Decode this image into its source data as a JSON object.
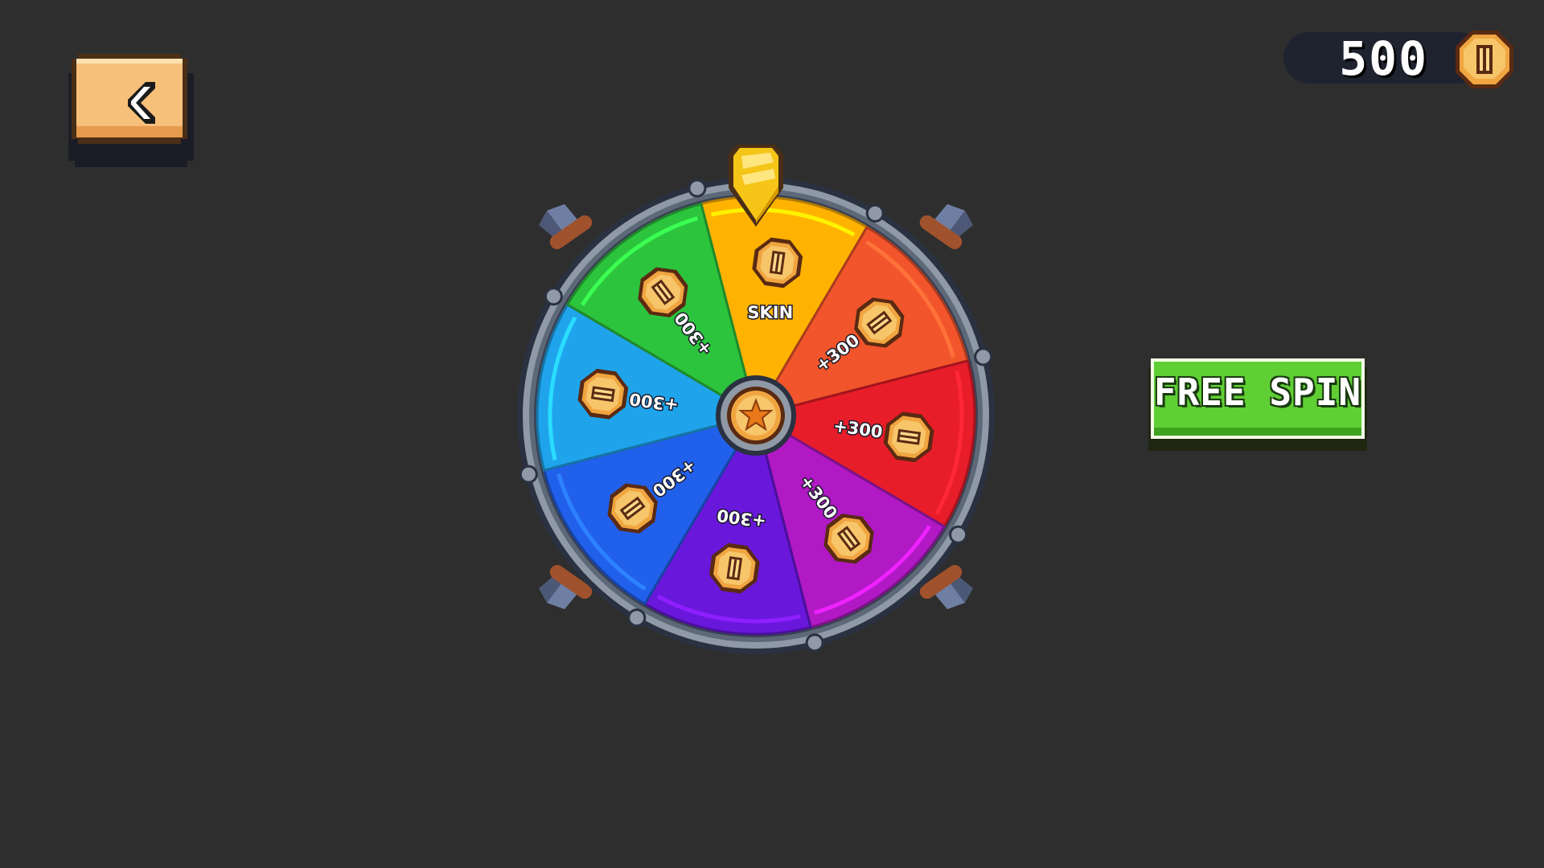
{
  "header": {
    "back_icon": "chevron-left-icon",
    "coin_count": "500",
    "coin_icon": "coin-icon"
  },
  "wheel": {
    "center_icon": "star-icon",
    "pointer_icon": "pointer-gem-icon",
    "segments": [
      {
        "label": "SKIN",
        "color": "#ffb300",
        "reward_icon": "coin-icon"
      },
      {
        "label": "+300",
        "color": "#f2552b",
        "reward_icon": "coin-icon"
      },
      {
        "label": "+300",
        "color": "#e81d2a",
        "reward_icon": "coin-icon"
      },
      {
        "label": "+300",
        "color": "#b019c4",
        "reward_icon": "coin-icon"
      },
      {
        "label": "+300",
        "color": "#6a17dc",
        "reward_icon": "coin-icon"
      },
      {
        "label": "+300",
        "color": "#2160ea",
        "reward_icon": "coin-icon"
      },
      {
        "label": "+300",
        "color": "#1fa4ec",
        "reward_icon": "coin-icon"
      },
      {
        "label": "+300",
        "color": "#2cc43d",
        "reward_icon": "coin-icon"
      }
    ]
  },
  "actions": {
    "free_spin_label": "FREE SPIN"
  },
  "colors": {
    "background": "#2e2e2e",
    "back_button": "#f7c07a",
    "free_spin_button": "#5fcf34",
    "rim": "#8f9aa6",
    "coin": "#f0a540"
  }
}
